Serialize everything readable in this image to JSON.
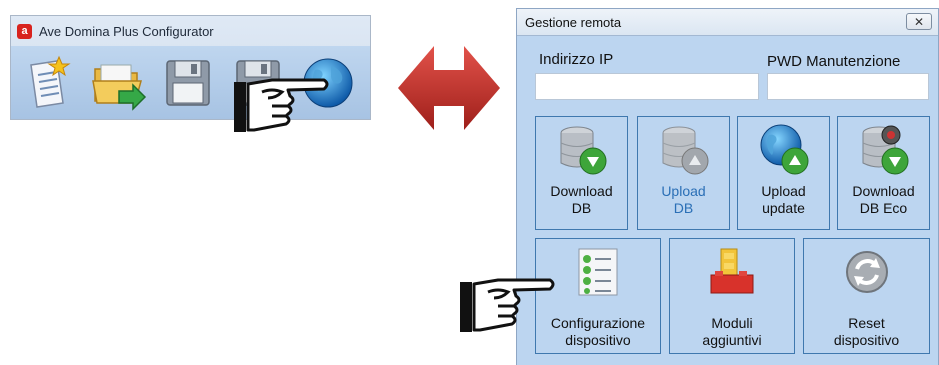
{
  "app_window": {
    "title": "Ave Domina Plus Configurator",
    "logo_letter": "a",
    "toolbar": [
      {
        "name": "new-project",
        "icon": "new-document-icon"
      },
      {
        "name": "open-project",
        "icon": "open-folder-icon"
      },
      {
        "name": "save-project",
        "icon": "floppy-disk-icon"
      },
      {
        "name": "save-as-project",
        "icon": "floppy-disk-icon"
      },
      {
        "name": "remote-management",
        "icon": "globe-icon"
      }
    ]
  },
  "dialog": {
    "title": "Gestione remota",
    "close_glyph": "✕",
    "ip_label": "Indirizzo IP",
    "ip_value": "",
    "pwd_label": "PWD Manutenzione",
    "pwd_value": "",
    "row1": [
      {
        "label1": "Download",
        "label2": "DB",
        "icon": "database-download-icon",
        "enabled": true
      },
      {
        "label1": "Upload",
        "label2": "DB",
        "icon": "database-upload-icon",
        "enabled": false
      },
      {
        "label1": "Upload",
        "label2": "update",
        "icon": "globe-upload-icon",
        "enabled": true
      },
      {
        "label1": "Download",
        "label2": "DB Eco",
        "icon": "database-eco-download-icon",
        "enabled": true
      }
    ],
    "row2": [
      {
        "label1": "Configurazione",
        "label2": "dispositivo",
        "icon": "checklist-icon"
      },
      {
        "label1": "Moduli",
        "label2": "aggiuntivi",
        "icon": "lego-bricks-icon"
      },
      {
        "label1": "Reset",
        "label2": "dispositivo",
        "icon": "refresh-icon"
      }
    ]
  },
  "colors": {
    "arrow": "#c0302a",
    "dialog_bg": "#bcd5f0",
    "button_border": "#3f78ae",
    "disabled_text": "#2a6fb6"
  }
}
